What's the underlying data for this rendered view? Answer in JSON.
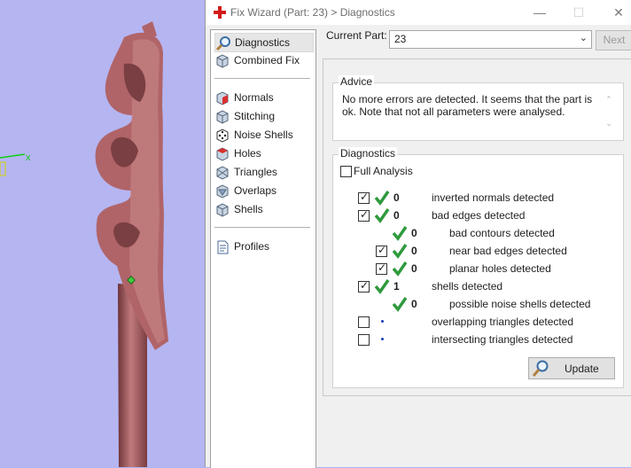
{
  "window": {
    "title": "Fix Wizard (Part: 23) > Diagnostics",
    "minimize": "—",
    "maximize": "☐",
    "close": "✕"
  },
  "sidebar": {
    "items": [
      {
        "label": "Diagnostics",
        "icon": "magnifier-icon"
      },
      {
        "label": "Combined Fix",
        "icon": "cube-icon"
      },
      {
        "label": "Normals",
        "icon": "normals-cube-icon"
      },
      {
        "label": "Stitching",
        "icon": "stitching-cube-icon"
      },
      {
        "label": "Noise Shells",
        "icon": "dice-icon"
      },
      {
        "label": "Holes",
        "icon": "holes-cube-icon"
      },
      {
        "label": "Triangles",
        "icon": "triangles-icon"
      },
      {
        "label": "Overlaps",
        "icon": "overlaps-icon"
      },
      {
        "label": "Shells",
        "icon": "shells-icon"
      },
      {
        "label": "Profiles",
        "icon": "document-icon"
      }
    ]
  },
  "part": {
    "label": "Current Part:",
    "value": "23",
    "next": "Next"
  },
  "advice": {
    "title": "Advice",
    "text": "No more errors are detected. It seems that the part is ok. Note that not all parameters were analysed."
  },
  "diagnostics": {
    "title": "Diagnostics",
    "full_analysis": "Full Analysis",
    "rows": [
      {
        "checked": true,
        "ok": true,
        "count": "0",
        "label": "inverted normals detected"
      },
      {
        "checked": true,
        "ok": true,
        "count": "0",
        "label": "bad edges detected"
      },
      {
        "checked": null,
        "ok": true,
        "count": "0",
        "label": "bad contours detected"
      },
      {
        "checked": true,
        "ok": true,
        "count": "0",
        "label": "near bad edges detected"
      },
      {
        "checked": true,
        "ok": true,
        "count": "0",
        "label": "planar holes detected"
      },
      {
        "checked": true,
        "ok": true,
        "count": "1",
        "label": "shells detected"
      },
      {
        "checked": null,
        "ok": true,
        "count": "0",
        "label": "possible noise shells detected"
      },
      {
        "checked": false,
        "ok": false,
        "count": "",
        "label": "overlapping triangles detected"
      },
      {
        "checked": false,
        "ok": false,
        "count": "",
        "label": "intersecting triangles detected"
      }
    ],
    "update": "Update"
  },
  "viewport": {
    "axis_label": "x",
    "background": "#b5b5f2",
    "part_color": "#b86b6e"
  }
}
